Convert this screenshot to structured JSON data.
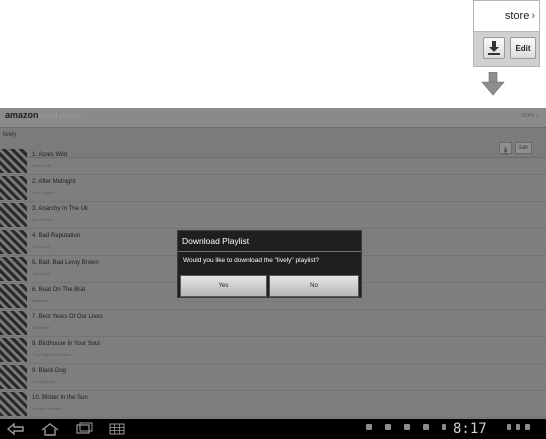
{
  "callout": {
    "store_label": "store",
    "chevron": "›",
    "download_icon": "download-icon",
    "edit_label": "Edit"
  },
  "app": {
    "logo_brand": "amazon",
    "logo_product": "cloud player",
    "store_label": "store ›",
    "playlist_name": "lively",
    "edit_label": "Edit"
  },
  "tracks": [
    {
      "title": "1. Acres Wild",
      "artist": "Jethro Tull"
    },
    {
      "title": "2. After Midnight",
      "artist": "Eric Clapton"
    },
    {
      "title": "3. Anarchy In The Uk",
      "artist": "Sex Pistols"
    },
    {
      "title": "4. Bad Reputation",
      "artist": "Thin Lizzy"
    },
    {
      "title": "5. Bad, Bad Leroy Brown",
      "artist": "Jim Croce"
    },
    {
      "title": "6. Beat On The Brat",
      "artist": "Ramones"
    },
    {
      "title": "7. Best Years Of Our Lives",
      "artist": "Baha Men"
    },
    {
      "title": "8. Birdhouse In Your Soul",
      "artist": "They Might Be Giants"
    },
    {
      "title": "9. Black Dog",
      "artist": "Led Zeppelin"
    },
    {
      "title": "10. Blister In the Sun",
      "artist": "Violent Femmes"
    }
  ],
  "dialog": {
    "title": "Download Playlist",
    "message": "Would you like to download the \"lively\" playlist?",
    "yes_label": "Yes",
    "no_label": "No"
  },
  "system_bar": {
    "time": "8:17"
  },
  "colors": {
    "dialog_background": "#1f1f1f",
    "dimmed_screen": "#7e7e7e",
    "system_bar": "#000000"
  }
}
